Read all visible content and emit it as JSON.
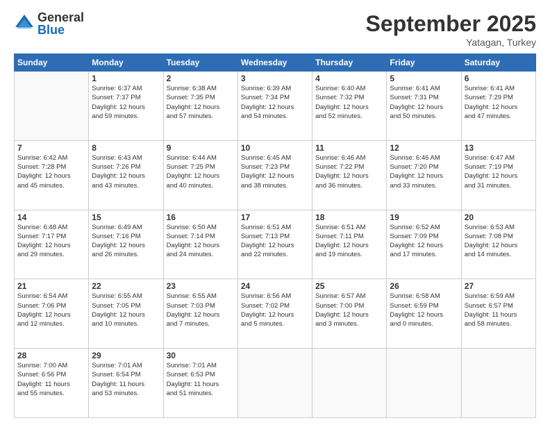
{
  "logo": {
    "general": "General",
    "blue": "Blue"
  },
  "header": {
    "month": "September 2025",
    "location": "Yatagan, Turkey"
  },
  "weekdays": [
    "Sunday",
    "Monday",
    "Tuesday",
    "Wednesday",
    "Thursday",
    "Friday",
    "Saturday"
  ],
  "weeks": [
    [
      {
        "day": null
      },
      {
        "day": "1",
        "sunrise": "6:37 AM",
        "sunset": "7:37 PM",
        "daylight": "12 hours and 59 minutes."
      },
      {
        "day": "2",
        "sunrise": "6:38 AM",
        "sunset": "7:35 PM",
        "daylight": "12 hours and 57 minutes."
      },
      {
        "day": "3",
        "sunrise": "6:39 AM",
        "sunset": "7:34 PM",
        "daylight": "12 hours and 54 minutes."
      },
      {
        "day": "4",
        "sunrise": "6:40 AM",
        "sunset": "7:32 PM",
        "daylight": "12 hours and 52 minutes."
      },
      {
        "day": "5",
        "sunrise": "6:41 AM",
        "sunset": "7:31 PM",
        "daylight": "12 hours and 50 minutes."
      },
      {
        "day": "6",
        "sunrise": "6:41 AM",
        "sunset": "7:29 PM",
        "daylight": "12 hours and 47 minutes."
      }
    ],
    [
      {
        "day": "7",
        "sunrise": "6:42 AM",
        "sunset": "7:28 PM",
        "daylight": "12 hours and 45 minutes."
      },
      {
        "day": "8",
        "sunrise": "6:43 AM",
        "sunset": "7:26 PM",
        "daylight": "12 hours and 43 minutes."
      },
      {
        "day": "9",
        "sunrise": "6:44 AM",
        "sunset": "7:25 PM",
        "daylight": "12 hours and 40 minutes."
      },
      {
        "day": "10",
        "sunrise": "6:45 AM",
        "sunset": "7:23 PM",
        "daylight": "12 hours and 38 minutes."
      },
      {
        "day": "11",
        "sunrise": "6:46 AM",
        "sunset": "7:22 PM",
        "daylight": "12 hours and 36 minutes."
      },
      {
        "day": "12",
        "sunrise": "6:46 AM",
        "sunset": "7:20 PM",
        "daylight": "12 hours and 33 minutes."
      },
      {
        "day": "13",
        "sunrise": "6:47 AM",
        "sunset": "7:19 PM",
        "daylight": "12 hours and 31 minutes."
      }
    ],
    [
      {
        "day": "14",
        "sunrise": "6:48 AM",
        "sunset": "7:17 PM",
        "daylight": "12 hours and 29 minutes."
      },
      {
        "day": "15",
        "sunrise": "6:49 AM",
        "sunset": "7:16 PM",
        "daylight": "12 hours and 26 minutes."
      },
      {
        "day": "16",
        "sunrise": "6:50 AM",
        "sunset": "7:14 PM",
        "daylight": "12 hours and 24 minutes."
      },
      {
        "day": "17",
        "sunrise": "6:51 AM",
        "sunset": "7:13 PM",
        "daylight": "12 hours and 22 minutes."
      },
      {
        "day": "18",
        "sunrise": "6:51 AM",
        "sunset": "7:11 PM",
        "daylight": "12 hours and 19 minutes."
      },
      {
        "day": "19",
        "sunrise": "6:52 AM",
        "sunset": "7:09 PM",
        "daylight": "12 hours and 17 minutes."
      },
      {
        "day": "20",
        "sunrise": "6:53 AM",
        "sunset": "7:08 PM",
        "daylight": "12 hours and 14 minutes."
      }
    ],
    [
      {
        "day": "21",
        "sunrise": "6:54 AM",
        "sunset": "7:06 PM",
        "daylight": "12 hours and 12 minutes."
      },
      {
        "day": "22",
        "sunrise": "6:55 AM",
        "sunset": "7:05 PM",
        "daylight": "12 hours and 10 minutes."
      },
      {
        "day": "23",
        "sunrise": "6:55 AM",
        "sunset": "7:03 PM",
        "daylight": "12 hours and 7 minutes."
      },
      {
        "day": "24",
        "sunrise": "6:56 AM",
        "sunset": "7:02 PM",
        "daylight": "12 hours and 5 minutes."
      },
      {
        "day": "25",
        "sunrise": "6:57 AM",
        "sunset": "7:00 PM",
        "daylight": "12 hours and 3 minutes."
      },
      {
        "day": "26",
        "sunrise": "6:58 AM",
        "sunset": "6:59 PM",
        "daylight": "12 hours and 0 minutes."
      },
      {
        "day": "27",
        "sunrise": "6:59 AM",
        "sunset": "6:57 PM",
        "daylight": "11 hours and 58 minutes."
      }
    ],
    [
      {
        "day": "28",
        "sunrise": "7:00 AM",
        "sunset": "6:56 PM",
        "daylight": "11 hours and 55 minutes."
      },
      {
        "day": "29",
        "sunrise": "7:01 AM",
        "sunset": "6:54 PM",
        "daylight": "11 hours and 53 minutes."
      },
      {
        "day": "30",
        "sunrise": "7:01 AM",
        "sunset": "6:53 PM",
        "daylight": "11 hours and 51 minutes."
      },
      {
        "day": null
      },
      {
        "day": null
      },
      {
        "day": null
      },
      {
        "day": null
      }
    ]
  ]
}
